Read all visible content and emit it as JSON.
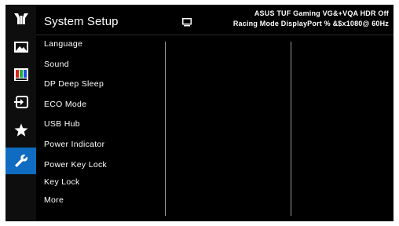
{
  "sidebar": {
    "items": [
      {
        "icon": "tuf-logo-icon",
        "active": false
      },
      {
        "icon": "image-icon",
        "active": false
      },
      {
        "icon": "color-bars-icon",
        "active": false
      },
      {
        "icon": "input-select-icon",
        "active": false
      },
      {
        "icon": "star-icon",
        "active": false
      },
      {
        "icon": "wrench-icon",
        "active": true
      }
    ],
    "active_color": "#0f6cc0"
  },
  "header": {
    "title": "System Setup",
    "status_icon": "monitor-icon",
    "info_line1": "ASUS TUF Gaming  VG&+VQA HDR Off",
    "info_line2": "Racing Mode  DisplayPort  % &$x1080@ 60Hz"
  },
  "menu": {
    "items": [
      {
        "label": "Language"
      },
      {
        "label": "Sound"
      },
      {
        "label": "DP Deep Sleep"
      },
      {
        "label": "ECO Mode"
      },
      {
        "label": "USB Hub"
      },
      {
        "label": "Power Indicator"
      },
      {
        "label": "Power Key Lock"
      },
      {
        "label": "Key Lock"
      },
      {
        "label": "More"
      }
    ]
  },
  "colors": {
    "panel": "#000000",
    "sidebar": "#0e0e0e",
    "text": "#ffffff",
    "divider": "#9a9a9a"
  }
}
